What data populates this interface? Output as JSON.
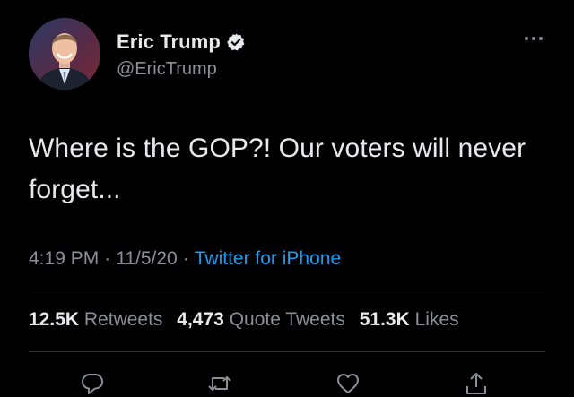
{
  "author": {
    "display_name": "Eric Trump",
    "handle": "@EricTrump",
    "verified": true,
    "avatar_icon": "profile-photo",
    "verified_icon": "verified-badge-icon"
  },
  "more_icon": "more-options-icon",
  "tweet": {
    "text": "Where is the GOP?! Our voters will never forget...",
    "time": "4:19 PM",
    "separator": "·",
    "date": "11/5/20",
    "source": "Twitter for iPhone"
  },
  "stats": {
    "retweets_count": "12.5K",
    "retweets_label": "Retweets",
    "quote_tweets_count": "4,473",
    "quote_tweets_label": "Quote Tweets",
    "likes_count": "51.3K",
    "likes_label": "Likes"
  },
  "actions": [
    "reply-icon",
    "retweet-icon",
    "like-icon",
    "share-icon"
  ],
  "colors": {
    "background": "#000000",
    "text_primary": "#e7e9ea",
    "text_secondary": "#8b9097",
    "link": "#1d9bf0",
    "divider": "#2f3336"
  }
}
